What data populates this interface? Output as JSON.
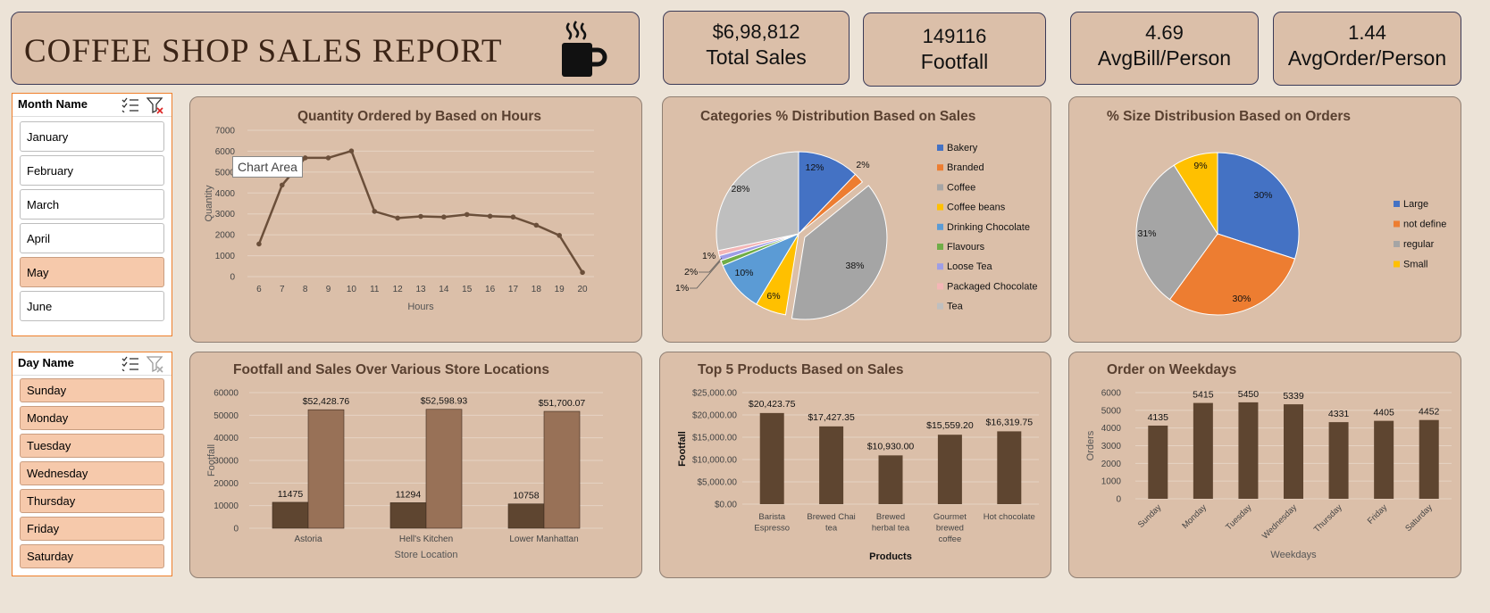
{
  "report_title": "COFFEE SHOP SALES REPORT",
  "kpis": [
    {
      "value": "$6,98,812",
      "label": "Total Sales"
    },
    {
      "value": "149116",
      "label": "Footfall"
    },
    {
      "value": "4.69",
      "label": "AvgBill/Person"
    },
    {
      "value": "1.44",
      "label": "AvgOrder/Person"
    }
  ],
  "month_slicer": {
    "title": "Month Name",
    "items": [
      {
        "label": "January",
        "selected": false
      },
      {
        "label": "February",
        "selected": false
      },
      {
        "label": "March",
        "selected": false
      },
      {
        "label": "April",
        "selected": false
      },
      {
        "label": "May",
        "selected": true
      },
      {
        "label": "June",
        "selected": false
      }
    ]
  },
  "day_slicer": {
    "title": "Day Name",
    "items": [
      {
        "label": "Sunday",
        "selected": true
      },
      {
        "label": "Monday",
        "selected": true
      },
      {
        "label": "Tuesday",
        "selected": true
      },
      {
        "label": "Wednesday",
        "selected": true
      },
      {
        "label": "Thursday",
        "selected": true
      },
      {
        "label": "Friday",
        "selected": true
      },
      {
        "label": "Saturday",
        "selected": true
      }
    ]
  },
  "tooltip": "Chart Area",
  "colors": {
    "dark_brown": "#5e4530",
    "mid_brown": "#987157",
    "card": "#dbbfa9",
    "slicer_accent": "#ef7f2a"
  },
  "chart_data": [
    {
      "type": "line",
      "title": "Quantity Ordered by Based on Hours",
      "xlabel": "Hours",
      "ylabel": "Quantity",
      "x": [
        6,
        7,
        8,
        9,
        10,
        11,
        12,
        13,
        14,
        15,
        16,
        17,
        18,
        19,
        20
      ],
      "values": [
        1560,
        4380,
        5680,
        5680,
        6010,
        3120,
        2800,
        2880,
        2850,
        2970,
        2890,
        2850,
        2460,
        1970,
        200
      ],
      "ylim": [
        0,
        7000
      ],
      "yticks": [
        0,
        1000,
        2000,
        3000,
        4000,
        5000,
        6000,
        7000
      ],
      "grid": true
    },
    {
      "type": "pie",
      "title": "Categories % Distribution Based on Sales",
      "labels": [
        "Bakery",
        "Branded",
        "Coffee",
        "Coffee beans",
        "Drinking Chocolate",
        "Flavours",
        "Loose Tea",
        "Packaged Chocolate",
        "Tea"
      ],
      "values": [
        12,
        2,
        38,
        6,
        10,
        1,
        1,
        1,
        28
      ],
      "data_labels": [
        "12%",
        "2%",
        "38%",
        "6%",
        "10%",
        "1%",
        "2%",
        "1%",
        "28%"
      ],
      "colors": [
        "#4472c4",
        "#ed7d31",
        "#a5a5a5",
        "#ffc000",
        "#5b9bd5",
        "#70ad47",
        "#9e9ee6",
        "#f4b6b6",
        "#bfbfbf"
      ],
      "legend": "right"
    },
    {
      "type": "pie",
      "title": "% Size Distribusion Based on Orders",
      "labels": [
        "Large",
        "not define",
        "regular",
        "Small"
      ],
      "values": [
        30,
        30,
        31,
        9
      ],
      "data_labels": [
        "30%",
        "30%",
        "31%",
        "9%"
      ],
      "colors": [
        "#4472c4",
        "#ed7d31",
        "#a5a5a5",
        "#ffc000"
      ],
      "legend": "right"
    },
    {
      "type": "bar",
      "title": "Footfall and Sales Over Various Store Locations",
      "xlabel": "Store Location",
      "ylabel": "Footfall",
      "categories": [
        "Astoria",
        "Hell's Kitchen",
        "Lower Manhattan"
      ],
      "series": [
        {
          "values": [
            11475,
            11294,
            10758
          ],
          "labels": [
            "11475",
            "11294",
            "10758"
          ]
        },
        {
          "values": [
            52428.76,
            52598.93,
            51700.07
          ],
          "labels": [
            "$52,428.76",
            "$52,598.93",
            "$51,700.07"
          ]
        }
      ],
      "ylim": [
        0,
        60000
      ],
      "yticks": [
        0,
        10000,
        20000,
        30000,
        40000,
        50000,
        60000
      ],
      "grid": true
    },
    {
      "type": "bar",
      "title": "Top 5 Products Based on Sales",
      "xlabel": "Products",
      "ylabel": "Footfall",
      "categories": [
        [
          "Barista",
          "Espresso"
        ],
        [
          "Brewed Chai",
          "tea"
        ],
        [
          "Brewed",
          "herbal tea"
        ],
        [
          "Gourmet",
          "brewed",
          "coffee"
        ],
        [
          "Hot chocolate"
        ]
      ],
      "values": [
        20423.75,
        17427.35,
        10930.0,
        15559.2,
        16319.75
      ],
      "value_labels": [
        "$20,423.75",
        "$17,427.35",
        "$10,930.00",
        "$15,559.20",
        "$16,319.75"
      ],
      "ylim": [
        0,
        25000
      ],
      "ytick_labels": [
        "$0.00",
        "$5,000.00",
        "$10,000.00",
        "$15,000.00",
        "$20,000.00",
        "$25,000.00"
      ],
      "grid": true
    },
    {
      "type": "bar",
      "title": "Order on Weekdays",
      "xlabel": "Weekdays",
      "ylabel": "Orders",
      "categories": [
        "Sunday",
        "Monday",
        "Tuesday",
        "Wednesday",
        "Thursday",
        "Friday",
        "Saturday"
      ],
      "values": [
        4135,
        5415,
        5450,
        5339,
        4331,
        4405,
        4452
      ],
      "ylim": [
        0,
        6000
      ],
      "yticks": [
        0,
        1000,
        2000,
        3000,
        4000,
        5000,
        6000
      ],
      "grid": true
    }
  ]
}
